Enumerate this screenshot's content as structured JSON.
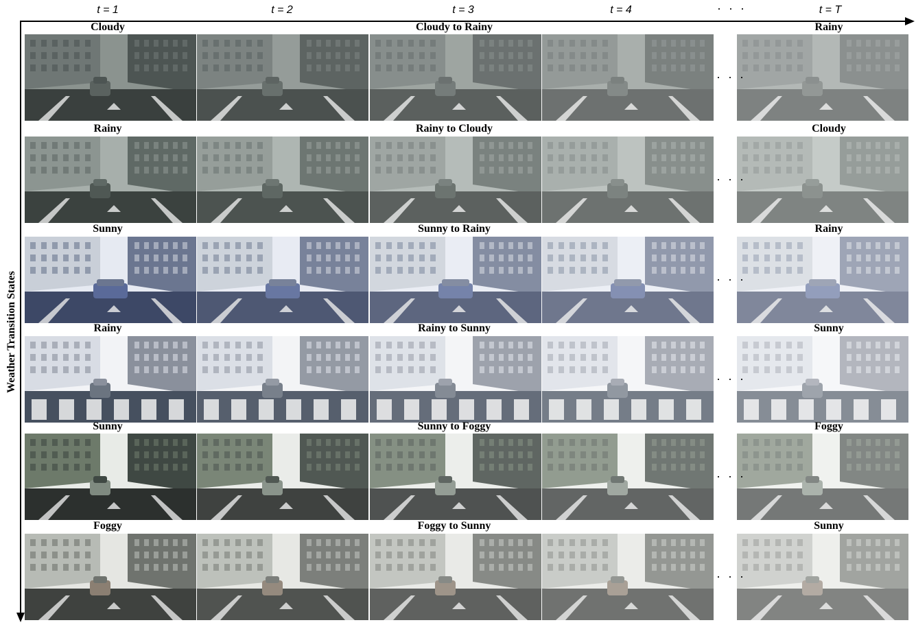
{
  "time_labels": [
    "t = 1",
    "t = 2",
    "t = 3",
    "t = 4",
    "t = T"
  ],
  "ellipsis": "· · ·",
  "y_axis_label": "Weather Transition States",
  "rows": [
    {
      "start": "Cloudy",
      "transition": "Cloudy to Rainy",
      "end": "Rainy",
      "palette": [
        "#6f7775",
        "#4d5553",
        "#3a403e",
        "#8b938f",
        "#5a625f"
      ]
    },
    {
      "start": "Rainy",
      "transition": "Rainy to Cloudy",
      "end": "Cloudy",
      "palette": [
        "#8c9591",
        "#5f6965",
        "#3b423f",
        "#a7afab",
        "#4f5854"
      ]
    },
    {
      "start": "Sunny",
      "transition": "Sunny to Rainy",
      "end": "Rainy",
      "palette": [
        "#c9cfd8",
        "#6b7690",
        "#3d4866",
        "#e6eaf2",
        "#5a6a99"
      ]
    },
    {
      "start": "Rainy",
      "transition": "Rainy to Sunny",
      "end": "Sunny",
      "palette": [
        "#d8dce4",
        "#8a909c",
        "#46505f",
        "#f2f3f6",
        "#6b7480"
      ]
    },
    {
      "start": "Sunny",
      "transition": "Sunny to Foggy",
      "end": "Foggy",
      "palette": [
        "#6d7a6a",
        "#3f4843",
        "#2c302e",
        "#e8ebe7",
        "#7f8a80"
      ]
    },
    {
      "start": "Foggy",
      "transition": "Foggy to Sunny",
      "end": "Sunny",
      "palette": [
        "#b7bbb5",
        "#6f736e",
        "#3f423f",
        "#e5e6e2",
        "#8b7f72"
      ]
    }
  ]
}
